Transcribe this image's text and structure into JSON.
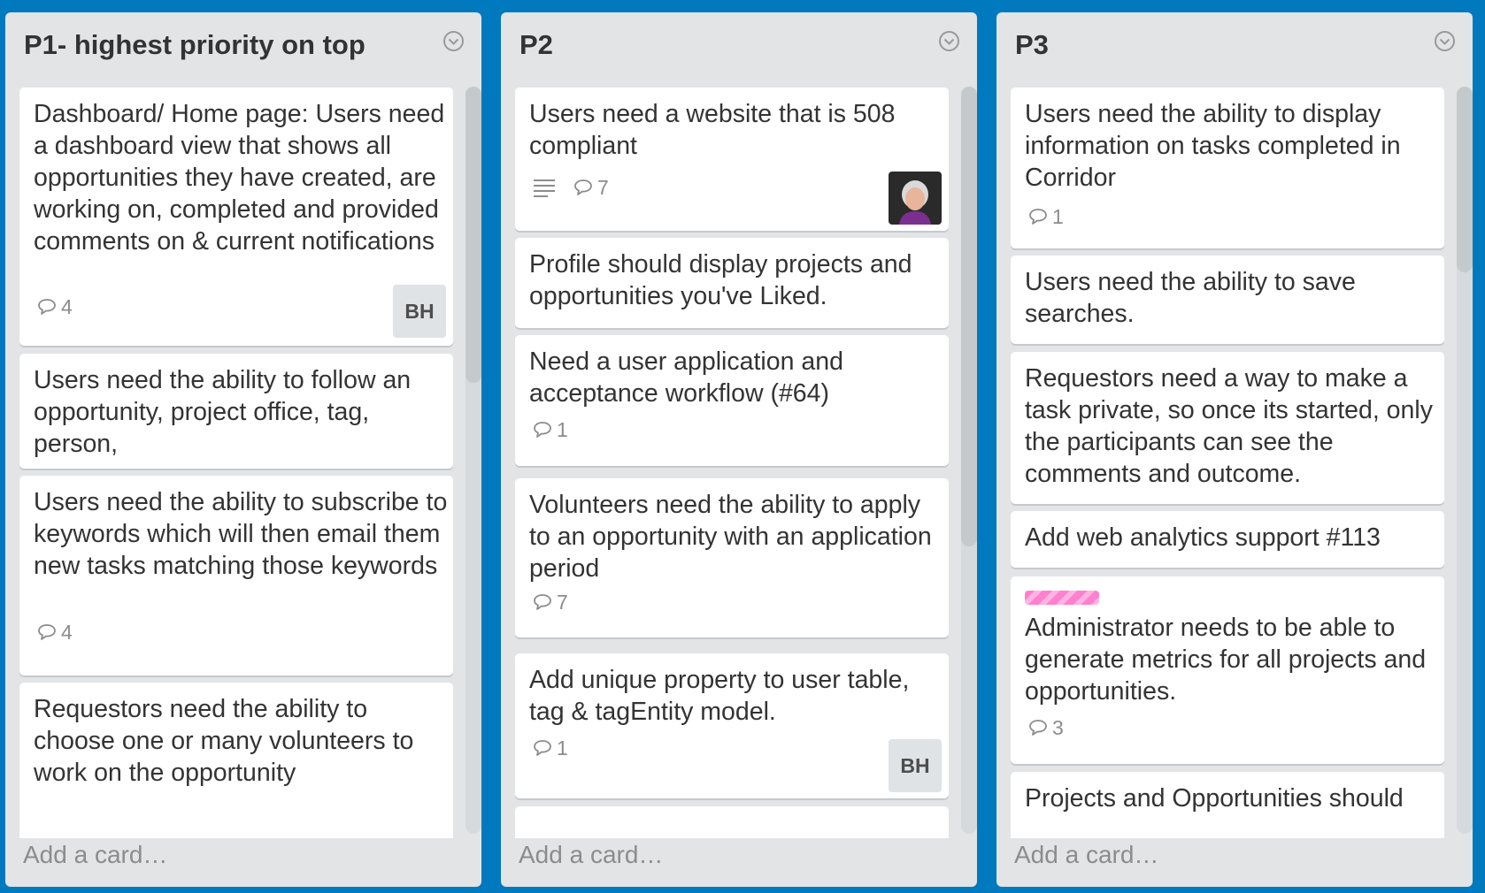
{
  "lists": [
    {
      "title": "P1- highest priority on top",
      "add_card": "Add a card…",
      "cards": [
        {
          "title": "Dashboard/ Home page: Users need a dashboard view that shows all opportunities they have created, are working on, completed and provided comments on & current notifications",
          "comments": "4",
          "member": "BH"
        },
        {
          "title": "Users need the ability to follow an opportunity, project office, tag, person,"
        },
        {
          "title": "Users need the ability to subscribe to keywords which will then email them new tasks matching those keywords",
          "comments": "4"
        },
        {
          "title": "Requestors need the ability to choose one or many volunteers to work on the opportunity"
        }
      ]
    },
    {
      "title": "P2",
      "add_card": "Add a card…",
      "cards": [
        {
          "title": "Users need a website that is 508 compliant",
          "has_description": true,
          "comments": "7",
          "member_avatar": "member-photo"
        },
        {
          "title": "Profile should display projects and opportunities you've Liked."
        },
        {
          "title": "Need a user application and acceptance workflow (#64)",
          "comments": "1"
        },
        {
          "title": "Volunteers need the ability to apply to an opportunity with an application period",
          "comments": "7"
        },
        {
          "title": "Add unique property to user table, tag & tagEntity model.",
          "comments": "1",
          "member": "BH"
        }
      ]
    },
    {
      "title": "P3",
      "add_card": "Add a card…",
      "cards": [
        {
          "title": "Users need the ability to display information on tasks completed in Corridor",
          "comments": "1"
        },
        {
          "title": "Users need the ability to save searches."
        },
        {
          "title": "Requestors need a way to make a task private, so once its started, only the participants can see the comments and outcome."
        },
        {
          "title": "Add web analytics support #113"
        },
        {
          "title": "Administrator needs to be able to generate metrics for all projects and opportunities.",
          "label_color": "#ff80ce",
          "comments": "3"
        },
        {
          "title": "Projects and Opportunities should"
        }
      ]
    }
  ],
  "icons": {
    "list_menu": "chevron-down-circle-icon",
    "comment": "speech-bubble-icon",
    "description": "description-lines-icon"
  },
  "colors": {
    "board_background": "#0079bf",
    "list_background": "#e2e4e6",
    "card_background": "#ffffff",
    "label_pink": "#ff80ce"
  }
}
